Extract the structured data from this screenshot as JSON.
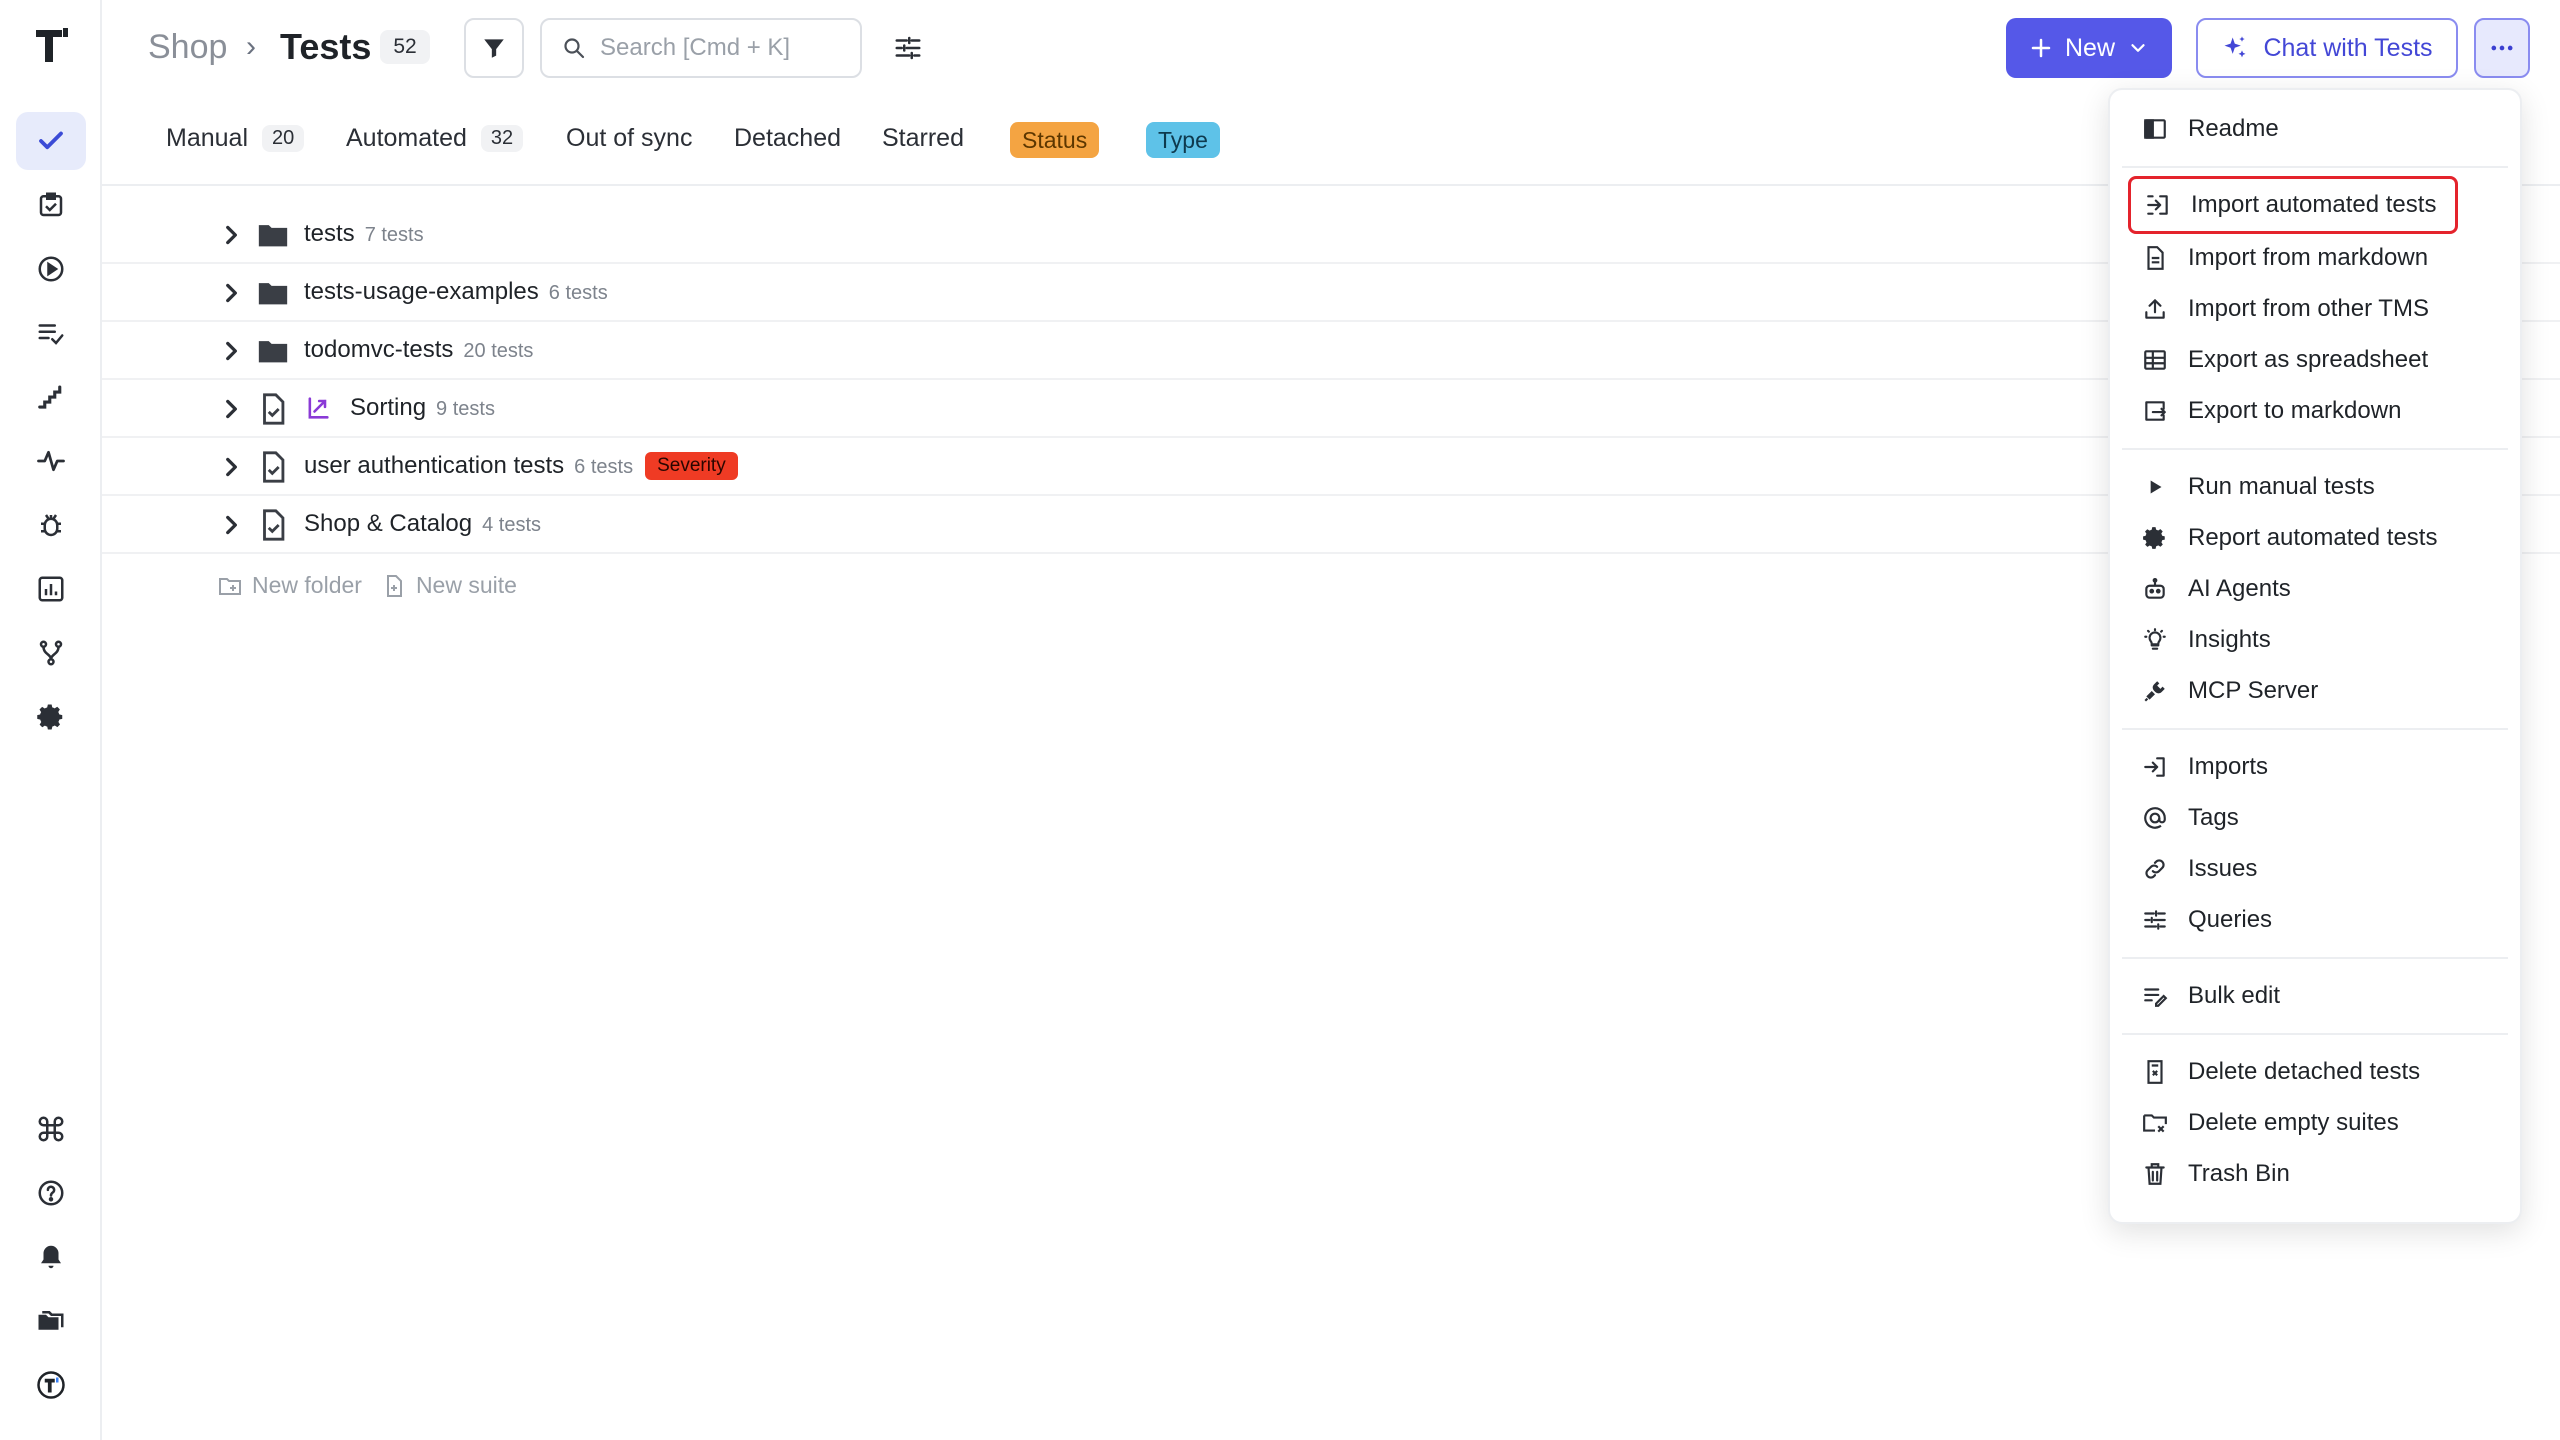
{
  "breadcrumb": {
    "project": "Shop",
    "separator": "›",
    "current": "Tests",
    "count": "52"
  },
  "search": {
    "placeholder": "Search [Cmd + K]"
  },
  "toolbar": {
    "new_label": "New",
    "chat_label": "Chat with Tests"
  },
  "tabs": [
    {
      "label": "Manual",
      "count": "20"
    },
    {
      "label": "Automated",
      "count": "32"
    },
    {
      "label": "Out of sync"
    },
    {
      "label": "Detached"
    },
    {
      "label": "Starred"
    },
    {
      "label": "Status"
    },
    {
      "label": "Type"
    }
  ],
  "tree": [
    {
      "name": "tests",
      "count": "7 tests",
      "kind": "folder"
    },
    {
      "name": "tests-usage-examples",
      "count": "6 tests",
      "kind": "folder"
    },
    {
      "name": "todomvc-tests",
      "count": "20 tests",
      "kind": "folder"
    },
    {
      "name": "Sorting",
      "count": "9 tests",
      "kind": "suite"
    },
    {
      "name": "user authentication tests",
      "count": "6 tests",
      "kind": "suite",
      "tag": "Severity"
    },
    {
      "name": "Shop & Catalog",
      "count": "4 tests",
      "kind": "suite"
    }
  ],
  "tree_actions": {
    "new_folder": "New folder",
    "new_suite": "New suite"
  },
  "menu": {
    "readme": "Readme",
    "import_automated": "Import automated tests",
    "import_markdown": "Import from markdown",
    "import_tms": "Import from other TMS",
    "export_spreadsheet": "Export as spreadsheet",
    "export_markdown": "Export to markdown",
    "run_manual": "Run manual tests",
    "report_automated": "Report automated tests",
    "ai_agents": "AI Agents",
    "insights": "Insights",
    "mcp_server": "MCP Server",
    "imports": "Imports",
    "tags": "Tags",
    "issues": "Issues",
    "queries": "Queries",
    "bulk_edit": "Bulk edit",
    "delete_detached": "Delete detached tests",
    "delete_empty": "Delete empty suites",
    "trash_bin": "Trash Bin"
  },
  "colors": {
    "accent": "#5558e8",
    "status_pill": "#f4a442",
    "type_pill": "#5ec2e8",
    "severity": "#ef3b24",
    "highlight_border": "#e4232c"
  }
}
